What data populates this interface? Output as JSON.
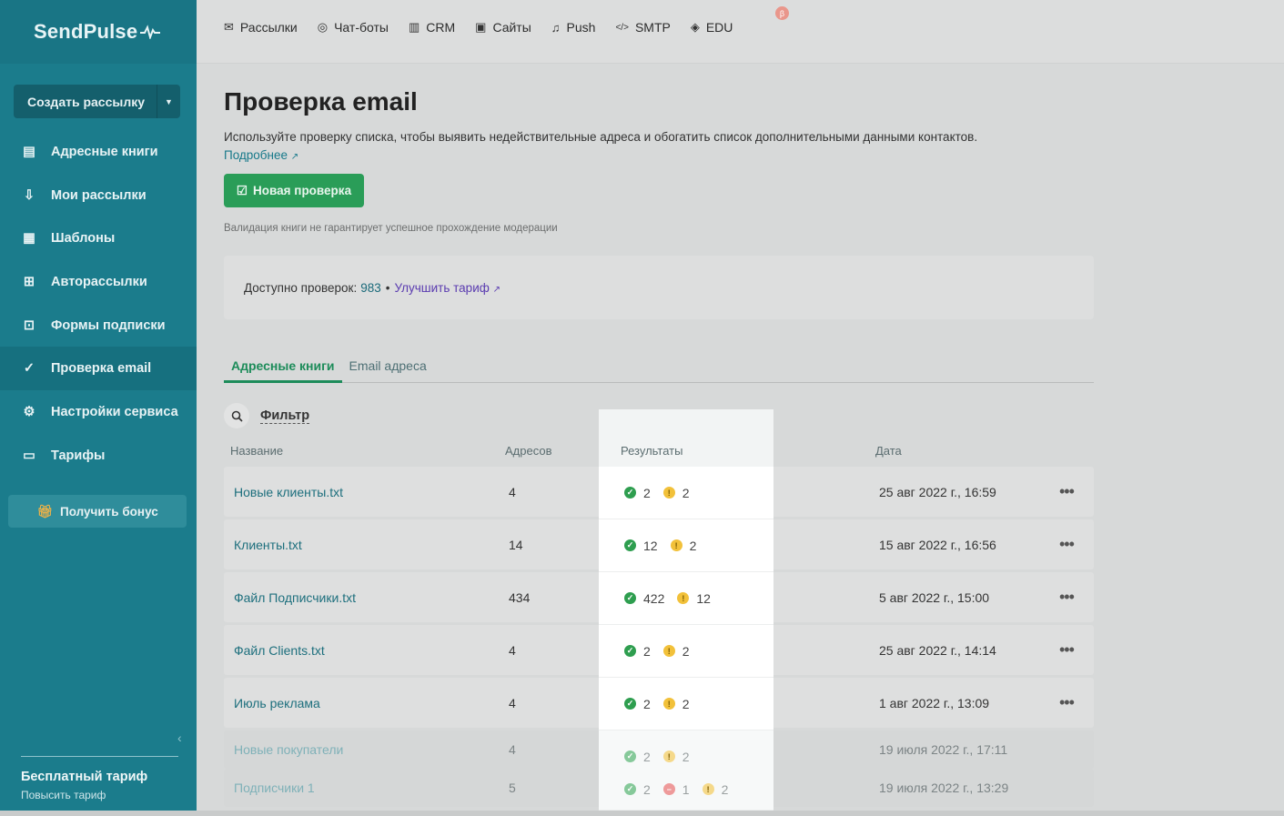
{
  "sidebar": {
    "logo": "SendPulse",
    "create_button": "Создать рассылку",
    "items": [
      {
        "label": "Адресные книги",
        "icon": "book-icon"
      },
      {
        "label": "Мои рассылки",
        "icon": "inbox-icon"
      },
      {
        "label": "Шаблоны",
        "icon": "template-icon"
      },
      {
        "label": "Авторассылки",
        "icon": "automation-icon"
      },
      {
        "label": "Формы подписки",
        "icon": "form-icon"
      },
      {
        "label": "Проверка email",
        "icon": "check-circle-icon"
      },
      {
        "label": "Настройки сервиса",
        "icon": "settings-icon"
      },
      {
        "label": "Тарифы",
        "icon": "tariff-icon"
      }
    ],
    "active_index": 5,
    "bonus_button": "Получить бонус",
    "plan_title": "Бесплатный тариф",
    "plan_upgrade": "Повысить тариф"
  },
  "topnav": {
    "items": [
      {
        "label": "Рассылки",
        "icon": "mail-icon"
      },
      {
        "label": "Чат-боты",
        "icon": "chat-icon"
      },
      {
        "label": "CRM",
        "icon": "crm-icon"
      },
      {
        "label": "Сайты",
        "icon": "site-icon"
      },
      {
        "label": "Push",
        "icon": "bell-icon"
      },
      {
        "label": "SMTP",
        "icon": "code-icon"
      },
      {
        "label": "EDU",
        "icon": "graduation-icon"
      }
    ],
    "beta_badge": "β"
  },
  "page": {
    "title": "Проверка email",
    "description": "Используйте проверку списка, чтобы выявить недействительные адреса и обогатить список дополнительными данными контактов.",
    "more_link": "Подробнее",
    "new_check_button": "Новая проверка",
    "hint": "Валидация книги не гарантирует успешное прохождение модерации",
    "quota_label": "Доступно проверок:",
    "quota_value": "983",
    "quota_sep": "•",
    "upgrade_link": "Улучшить тариф",
    "tabs": [
      "Адресные книги",
      "Email адреса"
    ],
    "active_tab": 0,
    "filter_label": "Фильтр"
  },
  "table": {
    "columns": [
      "Название",
      "Адресов",
      "Результаты",
      "Дата"
    ],
    "rows": [
      {
        "name": "Новые клиенты.txt",
        "count": "4",
        "ok": "2",
        "err": "",
        "warn": "2",
        "date": "25 авг 2022 г., 16:59",
        "faded": false
      },
      {
        "name": "Клиенты.txt",
        "count": "14",
        "ok": "12",
        "err": "",
        "warn": "2",
        "date": "15 авг 2022 г., 16:56",
        "faded": false
      },
      {
        "name": "Файл Подписчики.txt",
        "count": "434",
        "ok": "422",
        "err": "",
        "warn": "12",
        "date": "5 авг 2022 г., 15:00",
        "faded": false
      },
      {
        "name": "Файл Clients.txt",
        "count": "4",
        "ok": "2",
        "err": "",
        "warn": "2",
        "date": "25 авг 2022 г., 14:14",
        "faded": false
      },
      {
        "name": "Июль реклама",
        "count": "4",
        "ok": "2",
        "err": "",
        "warn": "2",
        "date": "1 авг 2022 г., 13:09",
        "faded": false
      },
      {
        "name": "Новые покупатели",
        "count": "4",
        "ok": "2",
        "err": "",
        "warn": "2",
        "date": "19 июля 2022 г., 17:11",
        "faded": true
      },
      {
        "name": "Подписчики 1",
        "count": "5",
        "ok": "2",
        "err": "1",
        "warn": "2",
        "date": "19 июля 2022 г., 13:29",
        "faded": true
      }
    ],
    "row_menu": "•••"
  },
  "colors": {
    "sidebar": "#1b7c8c",
    "accent_green": "#2a9d58",
    "ok": "#2e9e4f",
    "warn": "#f2c13a",
    "err": "#e05252"
  }
}
